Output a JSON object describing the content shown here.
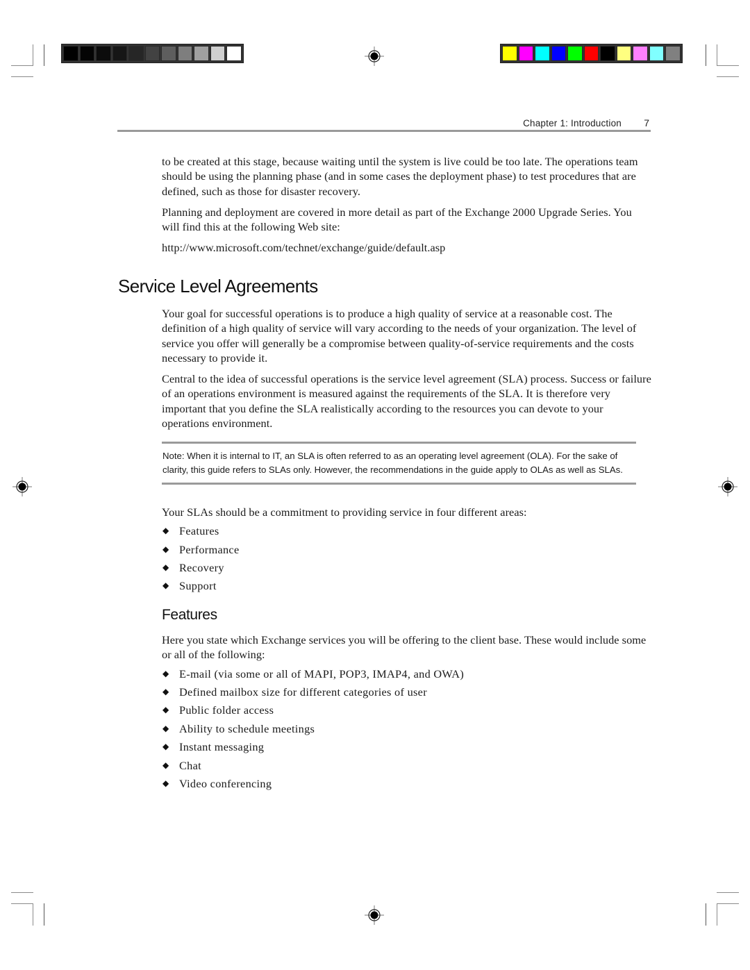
{
  "print_marks": {
    "grayscale_swatches": [
      "#000000",
      "#040404",
      "#0c0c0c",
      "#161616",
      "#262626",
      "#424242",
      "#5e5e5e",
      "#7e7e7e",
      "#a0a0a0",
      "#cfcfcf",
      "#ffffff"
    ],
    "color_swatches": [
      "#ffff00",
      "#ff00ff",
      "#00ffff",
      "#0000ff",
      "#00ff00",
      "#ff0000",
      "#000000",
      "#ffff80",
      "#ff80ff",
      "#80ffff",
      "#808080"
    ]
  },
  "header": {
    "chapter": "Chapter 1:  Introduction",
    "page_number": "7"
  },
  "intro": {
    "paragraphs": [
      "to be created at this stage, because waiting until the system is live could be too late. The operations team should be using the planning phase (and in some cases the deployment phase) to test procedures that are defined, such as those for disaster recovery.",
      "Planning and deployment are covered in more detail as part of the Exchange 2000 Upgrade Series. You will find this at the following Web site:",
      "http://www.microsoft.com/technet/exchange/guide/default.asp"
    ]
  },
  "section": {
    "title": "Service Level Agreements",
    "paragraphs": [
      "Your goal for successful operations is to produce a high quality of service at a reasonable cost. The definition of a high quality of service will vary according to the needs of your organization. The level of service you offer will generally be a compromise between quality-of-service requirements and the costs necessary to provide it.",
      "Central to the idea of successful operations is the service level agreement (SLA) process. Success or failure of an operations environment is measured against the requirements of the SLA. It is therefore very important that you define the SLA realistically according to the resources you can devote to your operations environment."
    ],
    "note": "Note:  When it is internal to IT, an SLA is often referred to as an operating level agreement (OLA). For the sake of clarity, this guide refers to SLAs only. However, the recommendations in the guide apply to OLAs as well as SLAs.",
    "areas_intro": "Your SLAs should be a commitment to providing service in four different areas:",
    "bullet_glyph": "◆",
    "areas": [
      "Features",
      "Performance",
      "Recovery",
      "Support"
    ]
  },
  "features": {
    "title": "Features",
    "intro": "Here you state which Exchange services you will be offering to the client base. These would include some or all of the following:",
    "items": [
      "E-mail (via some or all of MAPI, POP3, IMAP4, and OWA)",
      "Defined mailbox size for different categories of user",
      "Public folder access",
      "Ability to schedule meetings",
      "Instant messaging",
      "Chat",
      "Video conferencing"
    ]
  }
}
